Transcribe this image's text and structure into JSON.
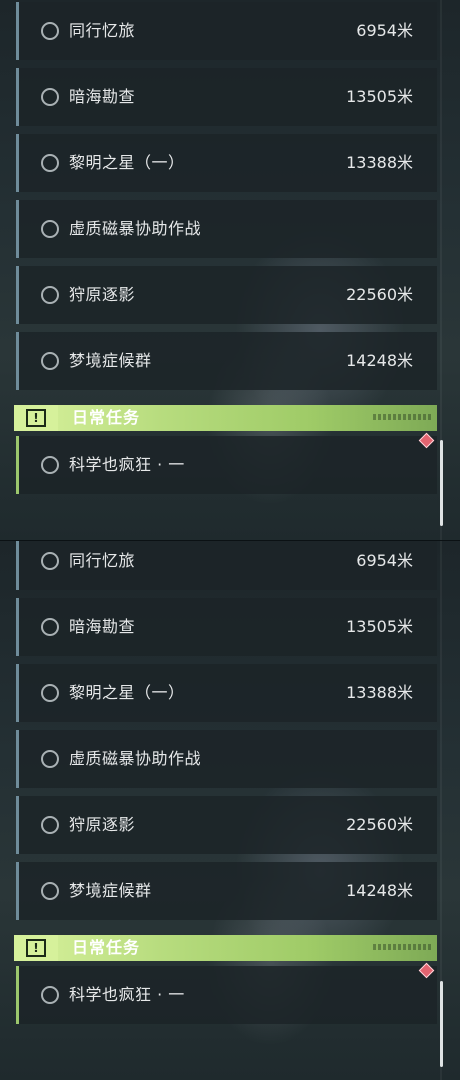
{
  "quests": [
    {
      "title": "同行忆旅",
      "distance": "6954米"
    },
    {
      "title": "暗海勘查",
      "distance": "13505米"
    },
    {
      "title": "黎明之星（一）",
      "distance": "13388米"
    },
    {
      "title": "虚质磁暴协助作战",
      "distance": ""
    },
    {
      "title": "狩原逐影",
      "distance": "22560米"
    },
    {
      "title": "梦境症候群",
      "distance": "14248米"
    }
  ],
  "daily_section": {
    "title": "日常任务",
    "icon": "alert-icon",
    "icon_glyph": "!",
    "tasks": [
      {
        "title": "科学也疯狂 · 一",
        "distance": ""
      }
    ]
  },
  "colors": {
    "accent_green": "#b7dc7e",
    "marker_red": "#e26470",
    "row_border": "#6f8c9a"
  }
}
